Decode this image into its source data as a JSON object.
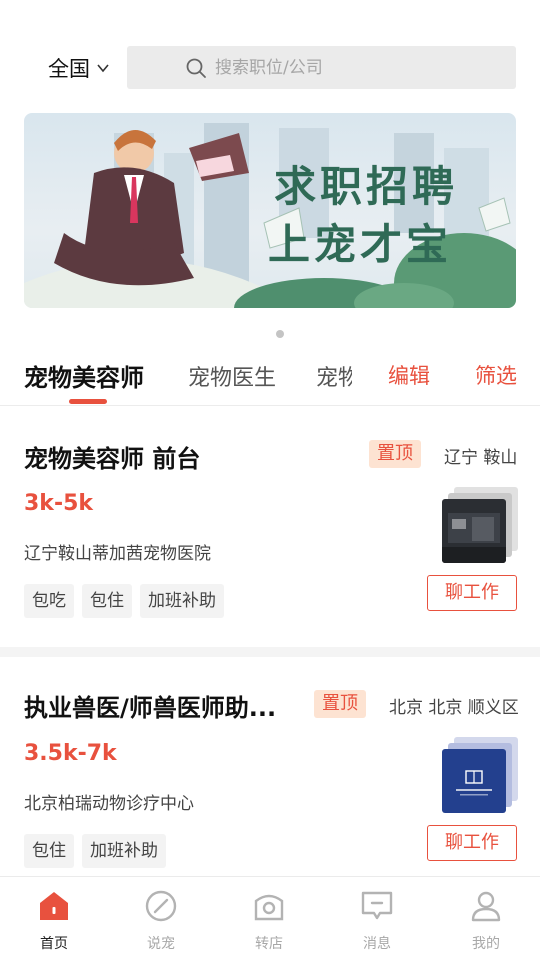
{
  "header": {
    "region": "全国",
    "search_placeholder": "搜索职位/公司"
  },
  "banner": {
    "line1": "求职招聘",
    "line2": "上宠才宝"
  },
  "tabs": {
    "items": [
      "宠物美容师",
      "宠物医生",
      "宠物"
    ],
    "edit": "编辑",
    "filter": "筛选"
  },
  "jobs": [
    {
      "title": "宠物美容师  前台",
      "pin": "置顶",
      "location": "辽宁 鞍山",
      "salary": "3k-5k",
      "company": "辽宁鞍山蒂加茜宠物医院",
      "tags": [
        "包吃",
        "包住",
        "加班补助"
      ],
      "chat": "聊工作"
    },
    {
      "title": "执业兽医/师兽医师助...",
      "pin": "置顶",
      "location": "北京 北京 顺义区",
      "salary": "3.5k-7k",
      "company": "北京柏瑞动物诊疗中心",
      "tags": [
        "包住",
        "加班补助"
      ],
      "chat": "聊工作"
    }
  ],
  "nav": {
    "items": [
      "首页",
      "说宠",
      "转店",
      "消息",
      "我的"
    ]
  },
  "colors": {
    "accent": "#e8513e",
    "pin_bg": "#fde3d2"
  }
}
